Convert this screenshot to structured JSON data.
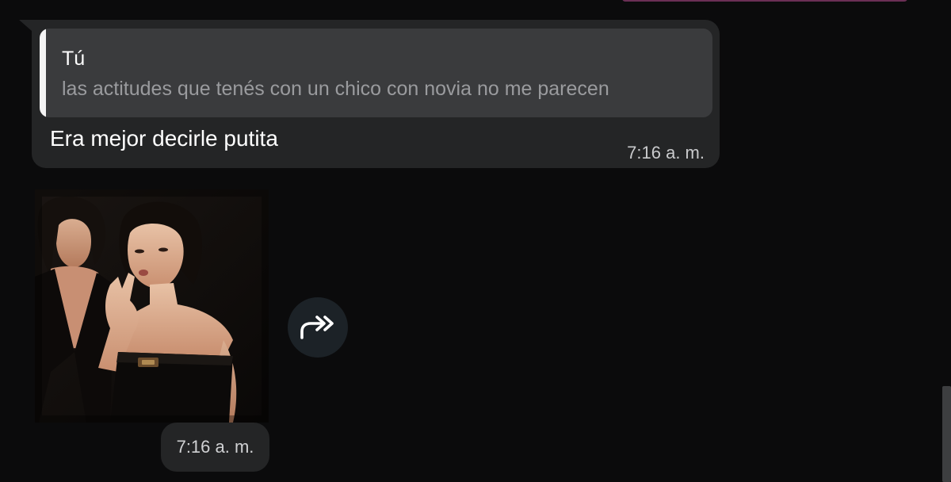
{
  "chat": {
    "message": {
      "reply_quote": {
        "author": "Tú",
        "text": "las actitudes que tenés con un chico con novia no me parecen"
      },
      "text": "Era mejor decirle putita",
      "time": "7:16 a. m."
    },
    "photo_message": {
      "image_alt": "photo",
      "time": "7:16 a. m."
    },
    "forward_icon": "forward-arrow-icon"
  },
  "colors": {
    "background": "#0b0b0c",
    "bubble": "#242526",
    "quote_background": "#3a3b3d",
    "quote_bar": "#f4f4f4",
    "quote_text": "#9a9b9e",
    "forward_button": "#1c2227",
    "accent_sliver": "#6b2f55"
  }
}
